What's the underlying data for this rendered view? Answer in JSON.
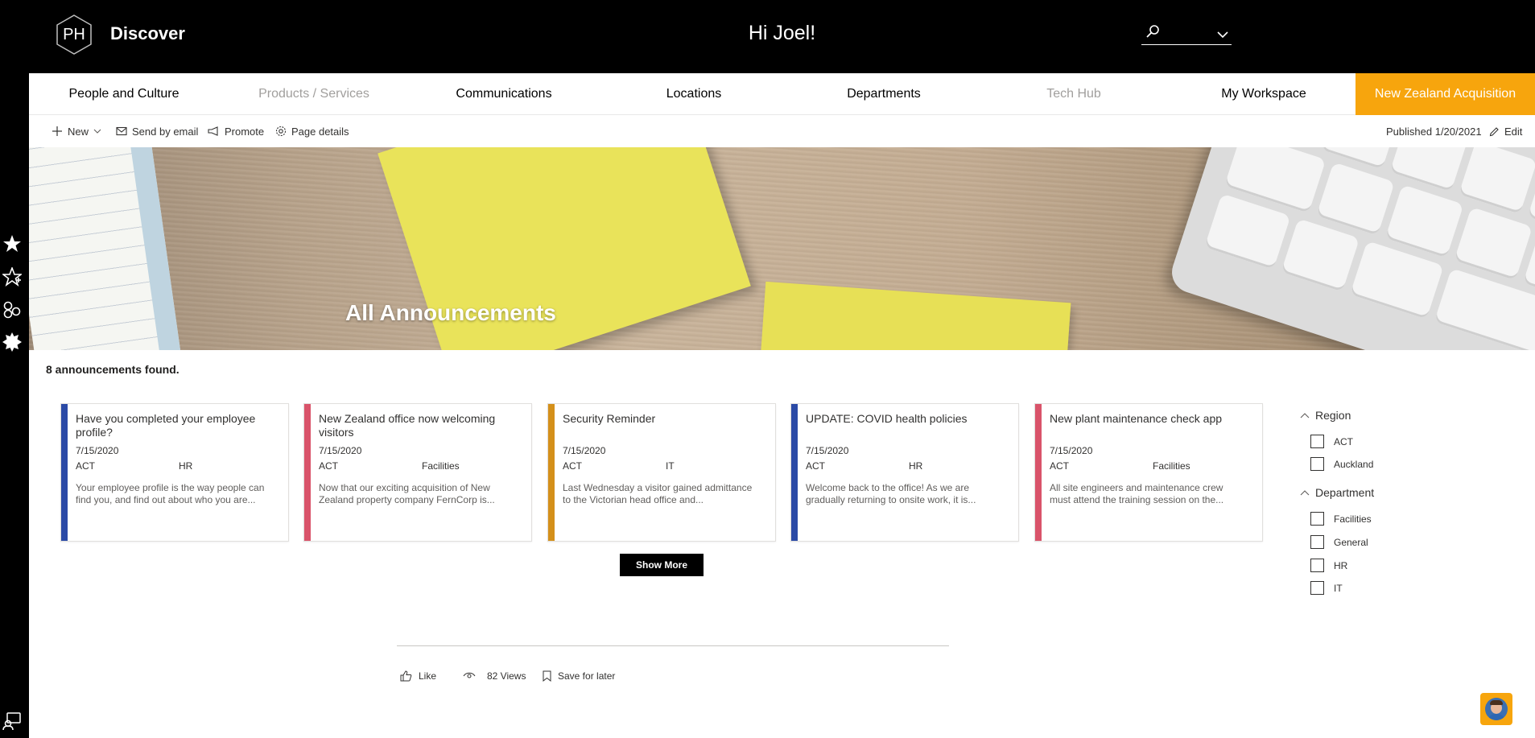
{
  "header": {
    "logo_text": "PH",
    "site_title": "Discover",
    "greeting": "Hi Joel!",
    "icons": [
      "search-icon",
      "chevron-down-icon"
    ]
  },
  "left_rail": {
    "icons": [
      "star-filled-icon",
      "star-outline-icon",
      "apps-icon",
      "settings-burst-icon",
      "feedback-icon"
    ]
  },
  "nav": {
    "items": [
      {
        "label": "People and Culture",
        "state": "normal"
      },
      {
        "label": "Products / Services",
        "state": "muted"
      },
      {
        "label": "Communications",
        "state": "normal"
      },
      {
        "label": "Locations",
        "state": "normal"
      },
      {
        "label": "Departments",
        "state": "normal"
      },
      {
        "label": "Tech Hub",
        "state": "muted"
      },
      {
        "label": "My Workspace",
        "state": "normal"
      },
      {
        "label": "New Zealand Acquisition",
        "state": "accent"
      }
    ],
    "accent_color": "#f7a50d"
  },
  "command_bar": {
    "new_label": "New",
    "send_email_label": "Send by email",
    "promote_label": "Promote",
    "page_details_label": "Page details",
    "published_text": "Published 1/20/2021",
    "edit_label": "Edit"
  },
  "hero": {
    "title": "All Announcements"
  },
  "results": {
    "found_text": "8 announcements found.",
    "cards": [
      {
        "title": "Have you completed your employee profile?",
        "date": "7/15/2020",
        "region": "ACT",
        "department": "HR",
        "description": "Your employee profile is the way people can find you, and find out about who you are...",
        "accent": "#2b4aa6"
      },
      {
        "title": "New Zealand office now welcoming visitors",
        "date": "7/15/2020",
        "region": "ACT",
        "department": "Facilities",
        "description": "Now that our exciting acquisition of New Zealand property company FernCorp is...",
        "accent": "#d9536a"
      },
      {
        "title": "Security Reminder",
        "date": "7/15/2020",
        "region": "ACT",
        "department": "IT",
        "description": "Last Wednesday a visitor gained admittance to the Victorian head office and...",
        "accent": "#d4901a"
      },
      {
        "title": "UPDATE: COVID health policies",
        "date": "7/15/2020",
        "region": "ACT",
        "department": "HR",
        "description": "Welcome back to the office!  As we are gradually returning to onsite work, it is...",
        "accent": "#2b4aa6"
      },
      {
        "title": "New plant maintenance check app",
        "date": "7/15/2020",
        "region": "ACT",
        "department": "Facilities",
        "description": "All site engineers and maintenance crew must attend the training session on the...",
        "accent": "#d9536a"
      }
    ],
    "show_more_label": "Show More"
  },
  "filters": {
    "region": {
      "heading": "Region",
      "options": [
        "ACT",
        "Auckland"
      ]
    },
    "department": {
      "heading": "Department",
      "options": [
        "Facilities",
        "General",
        "HR",
        "IT"
      ]
    }
  },
  "footer": {
    "like_label": "Like",
    "views_text": "82 Views",
    "save_label": "Save for later"
  }
}
